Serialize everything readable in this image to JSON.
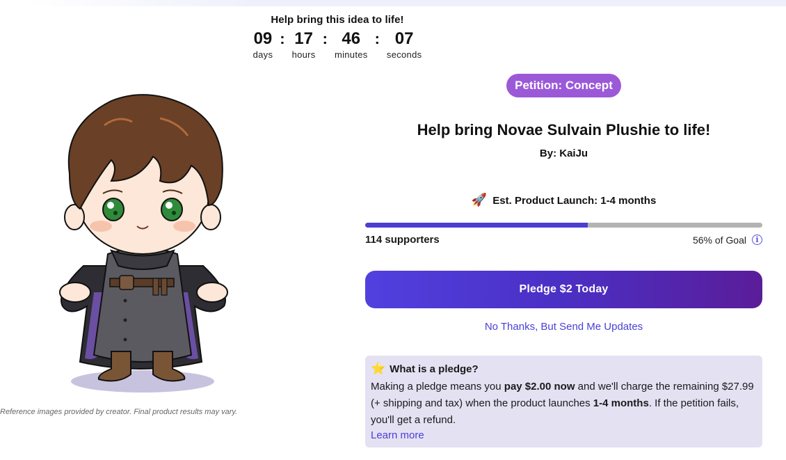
{
  "countdown": {
    "title": "Help bring this idea to life!",
    "units": [
      {
        "value": "09",
        "label": "days"
      },
      {
        "value": "17",
        "label": "hours"
      },
      {
        "value": "46",
        "label": "minutes"
      },
      {
        "value": "07",
        "label": "seconds"
      }
    ],
    "separator": ":"
  },
  "image": {
    "caption": "Reference images provided by creator. Final product results may vary."
  },
  "petition": {
    "badge": "Petition: Concept",
    "title": "Help bring Novae Sulvain Plushie to life!",
    "byline": "By: KaiJu",
    "launch_icon": "🚀",
    "launch": "Est. Product Launch: 1-4 months",
    "progress_percent": 56,
    "supporters": "114 supporters",
    "goal": "56% of Goal",
    "info_icon": "i",
    "pledge_button": "Pledge $2 Today",
    "updates_link": "No Thanks, But Send Me Updates"
  },
  "pledge_info": {
    "star_icon": "⭐",
    "heading": "What is a pledge?",
    "text_1": "Making a pledge means you ",
    "bold_1": "pay $2.00 now",
    "text_2": " and we'll charge the remaining $27.99 (+ shipping and tax) when the product launches ",
    "bold_2": "1-4 months",
    "text_3": ". If the petition fails, you'll get a refund.",
    "learn_more": "Learn more"
  },
  "colors": {
    "accent": "#4b3fd1",
    "badge": "#9b59d8",
    "link": "#4a3fd6",
    "info_bg": "#e4e1f3"
  }
}
